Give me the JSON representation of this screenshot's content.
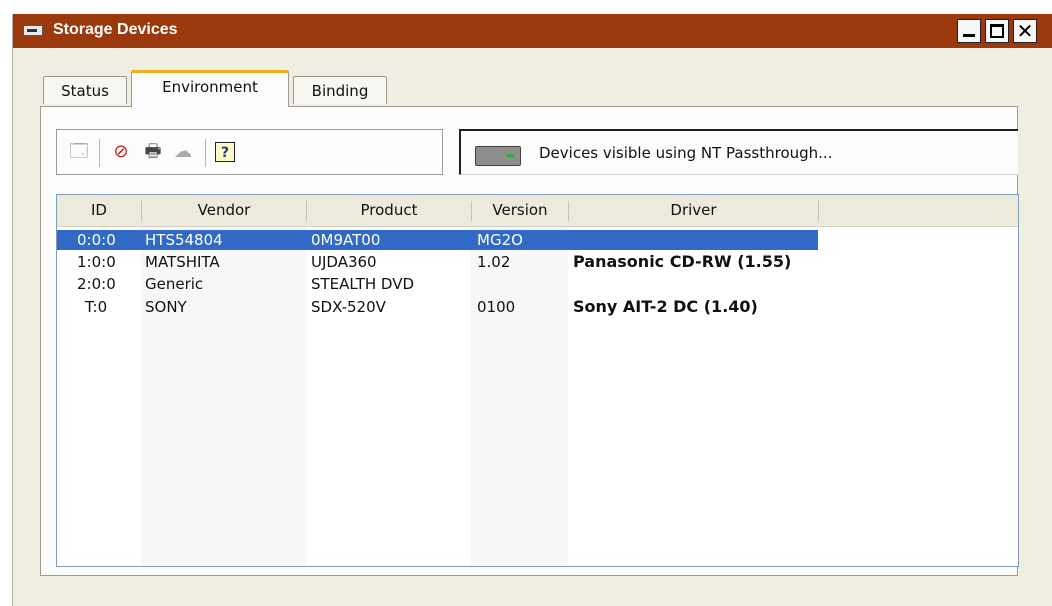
{
  "window": {
    "title": "Storage Devices",
    "controls": {
      "close_glyph": "✕"
    },
    "colors": {
      "titlebar": "#9a3a0c",
      "selection": "#316ac5",
      "active_tab_accent": "#f4a81c"
    }
  },
  "tabs": [
    {
      "label": "Status",
      "active": false
    },
    {
      "label": "Environment",
      "active": true
    },
    {
      "label": "Binding",
      "active": false
    }
  ],
  "toolbar": {
    "icons": [
      "properties-icon",
      "remove-device-icon",
      "printer-icon",
      "network-icon",
      "help-icon"
    ],
    "glyphs": {
      "properties": "🗔",
      "remove": "⊘",
      "printer": "🖶",
      "network": "☁",
      "help": "?"
    }
  },
  "info": {
    "text": "Devices visible using NT Passthrough..."
  },
  "table": {
    "columns": [
      "ID",
      "Vendor",
      "Product",
      "Version",
      "Driver"
    ],
    "rows": [
      {
        "id": "0:0:0",
        "vendor": "HTS54804",
        "product": "0M9AT00",
        "version": "MG2O",
        "driver": "",
        "selected": true
      },
      {
        "id": "1:0:0",
        "vendor": "MATSHITA",
        "product": "UJDA360",
        "version": "1.02",
        "driver": "Panasonic CD-RW (1.55)",
        "selected": false
      },
      {
        "id": "2:0:0",
        "vendor": "Generic",
        "product": "STEALTH DVD",
        "version": "",
        "driver": "",
        "selected": false
      },
      {
        "id": "T:0",
        "vendor": "SONY",
        "product": "SDX-520V",
        "version": "0100",
        "driver": "Sony AIT-2 DC (1.40)",
        "selected": false
      }
    ]
  }
}
